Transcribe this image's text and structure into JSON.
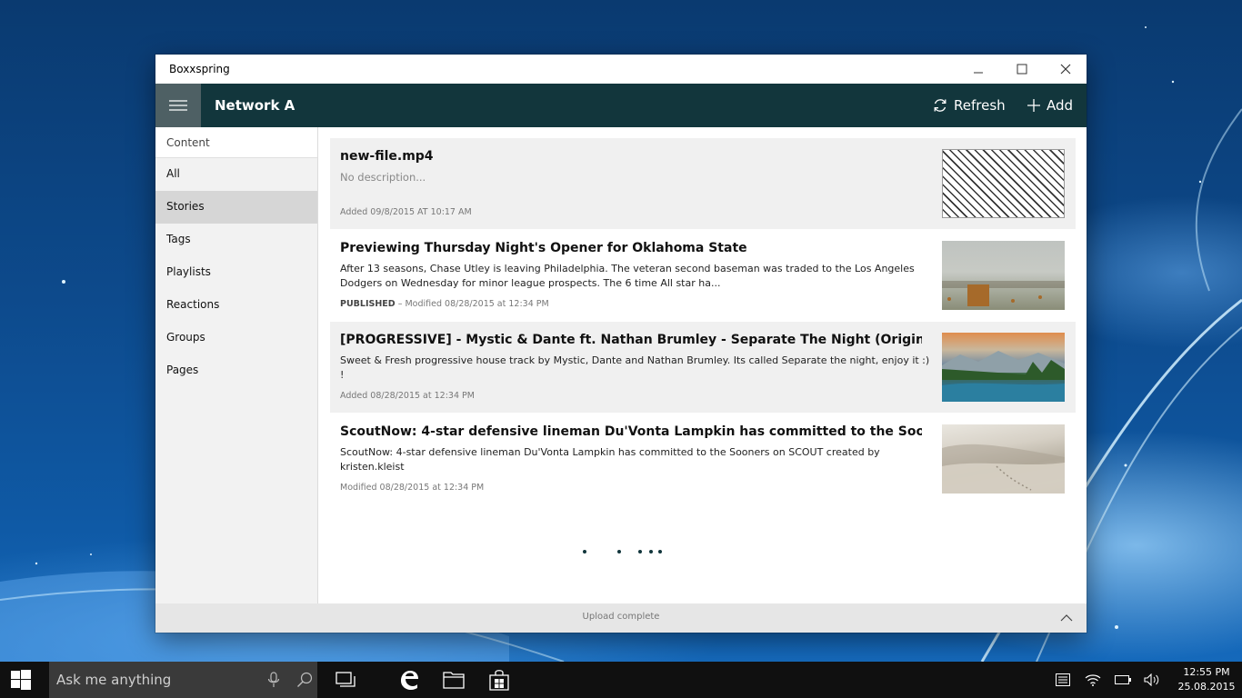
{
  "window": {
    "title": "Boxxspring"
  },
  "appbar": {
    "network_title": "Network A",
    "refresh_label": "Refresh",
    "add_label": "Add"
  },
  "sidebar": {
    "section_title": "Content",
    "items": [
      {
        "label": "All",
        "selected": false
      },
      {
        "label": "Stories",
        "selected": true
      },
      {
        "label": "Tags",
        "selected": false
      },
      {
        "label": "Playlists",
        "selected": false
      },
      {
        "label": "Reactions",
        "selected": false
      },
      {
        "label": "Groups",
        "selected": false
      },
      {
        "label": "Pages",
        "selected": false
      }
    ]
  },
  "content": {
    "items": [
      {
        "title": "new-file.mp4",
        "description": "No description...",
        "status": "",
        "meta": "Added 09/8/2015 AT 10:17 AM",
        "thumb": "placeholder-stripes"
      },
      {
        "title": "Previewing Thursday Night's Opener for Oklahoma State",
        "description": "After 13 seasons, Chase Utley is leaving Philadelphia. The veteran second baseman was traded to the Los Angeles Dodgers on Wednesday for minor league prospects. The 6 time All star ha...",
        "status": "PUBLISHED",
        "meta": " – Modified 08/28/2015 at 12:34 PM",
        "thumb": "foggy-landscape"
      },
      {
        "title": "[PROGRESSIVE] - Mystic & Dante ft. Nathan Brumley - Separate The Night (Origin...",
        "description": "Sweet & Fresh progressive house track by Mystic, Dante and Nathan Brumley. Its called Separate the night, enjoy it :) !",
        "status": "",
        "meta": "Added 08/28/2015 at 12:34 PM",
        "thumb": "mountain-lake"
      },
      {
        "title": "ScoutNow: 4-star defensive lineman Du'Vonta Lampkin has committed to the Soo...",
        "description": "ScoutNow: 4-star defensive lineman Du'Vonta Lampkin has committed to the Sooners on SCOUT created by kristen.kleist",
        "status": "",
        "meta": "Modified 08/28/2015 at 12:34 PM",
        "thumb": "desert-dunes"
      }
    ]
  },
  "statusbar": {
    "text": "Upload complete"
  },
  "taskbar": {
    "search_placeholder": "Ask me anything",
    "time": "12:55 PM",
    "date": "25.08.2015"
  },
  "colors": {
    "appbar": "#12363c",
    "hamburger_bg": "#4e6064",
    "selected_nav": "#d6d6d6",
    "taskbar": "#101010"
  }
}
